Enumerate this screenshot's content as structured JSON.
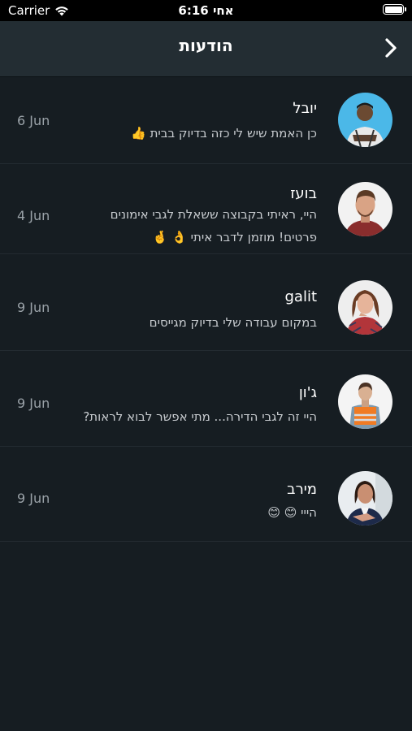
{
  "status_bar": {
    "carrier": "Carrier",
    "time": "6:16 אחי"
  },
  "nav": {
    "title": "הודעות"
  },
  "conversations": [
    {
      "name": "יובל",
      "lines": [
        "כן האמת שיש לי כזה בדיוק בבית 👍"
      ],
      "date": "6 Jun",
      "avatar_bg": "#4bb8e8"
    },
    {
      "name": "בועז",
      "lines": [
        "היי, ראיתי בקבוצה ששאלת לגבי אימונים",
        "פרטים! מוזמן לדבר איתי 👌 🤞"
      ],
      "date": "4 Jun",
      "avatar_bg": "#f2f2f2"
    },
    {
      "name": "galit",
      "lines": [
        "במקום עבודה שלי בדיוק מגייסים"
      ],
      "date": "9 Jun",
      "avatar_bg": "#eeeeee"
    },
    {
      "name": "ג'ון",
      "lines": [
        "היי זה לגבי הדירה... מתי אפשר לבוא לראות?"
      ],
      "date": "9 Jun",
      "avatar_bg": "#f4f4f4"
    },
    {
      "name": "מירב",
      "lines": [
        "הייי 😊 😊"
      ],
      "date": "9 Jun",
      "avatar_bg": "#e9edf0"
    }
  ]
}
